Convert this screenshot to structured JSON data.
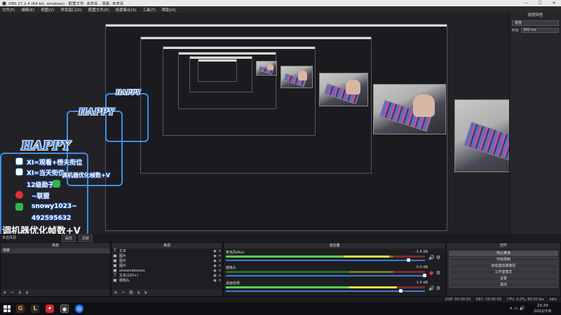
{
  "window": {
    "title": "OBS 27.2.4 (64-bit, windows) - 配置文件: 未命名 - 场景: 未命名",
    "controls": [
      "—",
      "☐",
      "✕"
    ]
  },
  "menu": [
    "文件(F)",
    "编辑(E)",
    "视图(V)",
    "停靠窗口(D)",
    "配置文件(P)",
    "场景集合(S)",
    "工具(T)",
    "帮助(H)"
  ],
  "preview": {
    "overlay": {
      "title": "HAPPY",
      "lines": [
        "XI=观看+榜夫衔位",
        "XI=当天衔位",
        "12级勋子",
        "~联盟",
        "snowy1023~",
        "492595632"
      ],
      "caption": "调机器优化帧数+V"
    },
    "no_source_label": "未选择源"
  },
  "filters_panel": {
    "title": "锐度特性",
    "select_value": "锐度",
    "row_label": "时长",
    "row_value": "300 ms"
  },
  "mode_buttons": [
    "属性",
    "滤镜"
  ],
  "scenes": {
    "title": "场景",
    "items": [
      "场景"
    ],
    "footer": [
      "+",
      "−",
      "∧",
      "∨"
    ]
  },
  "sources": {
    "title": "来源",
    "items": [
      {
        "icon": "T",
        "label": "文本"
      },
      {
        "icon": "▣",
        "label": "图片"
      },
      {
        "icon": "▣",
        "label": "图片"
      },
      {
        "icon": "▣",
        "label": "图片"
      },
      {
        "icon": "▣",
        "label": "streamdevices"
      },
      {
        "icon": "T",
        "label": "文本(GDI+)"
      },
      {
        "icon": "▣",
        "label": "摄像头"
      }
    ],
    "footer": [
      "+",
      "−",
      "⚙",
      "∧",
      "∨"
    ]
  },
  "mixer": {
    "title": "混音器",
    "tracks": [
      {
        "name": "麦克风/Aux",
        "db": "-1.6 dB",
        "level": 0.82,
        "volume": 0.92,
        "muted": false
      },
      {
        "name": "摄像头",
        "db": "0.0 dB",
        "level": 0.0,
        "volume": 1.0,
        "muted": true
      },
      {
        "name": "桌面音频",
        "db": "-1.4 dB",
        "level": 0.86,
        "volume": 0.88,
        "muted": false
      }
    ]
  },
  "controls": {
    "title": "控件",
    "buttons": [
      "停止推流",
      "开始录制",
      "启动虚拟摄像机",
      "工作室模式",
      "设置",
      "退出"
    ]
  },
  "status": {
    "live": "LIVE: 00:00:00",
    "rec": "REC: 00:00:00",
    "cpu": "CPU: 0.0%, 60.00 fps",
    "kbps": "kb/s"
  },
  "taskbar": {
    "time": "23:29",
    "date": "2022/7/8",
    "apps": [
      "G",
      "L",
      "✦",
      "◉",
      "◎"
    ]
  },
  "colors": {
    "overlay_border": "#3d8fe6",
    "accent_blue": "#3a7ad8",
    "meter_green": "#4fd44f",
    "meter_yellow": "#e0e040",
    "mute_red": "#e03030"
  }
}
